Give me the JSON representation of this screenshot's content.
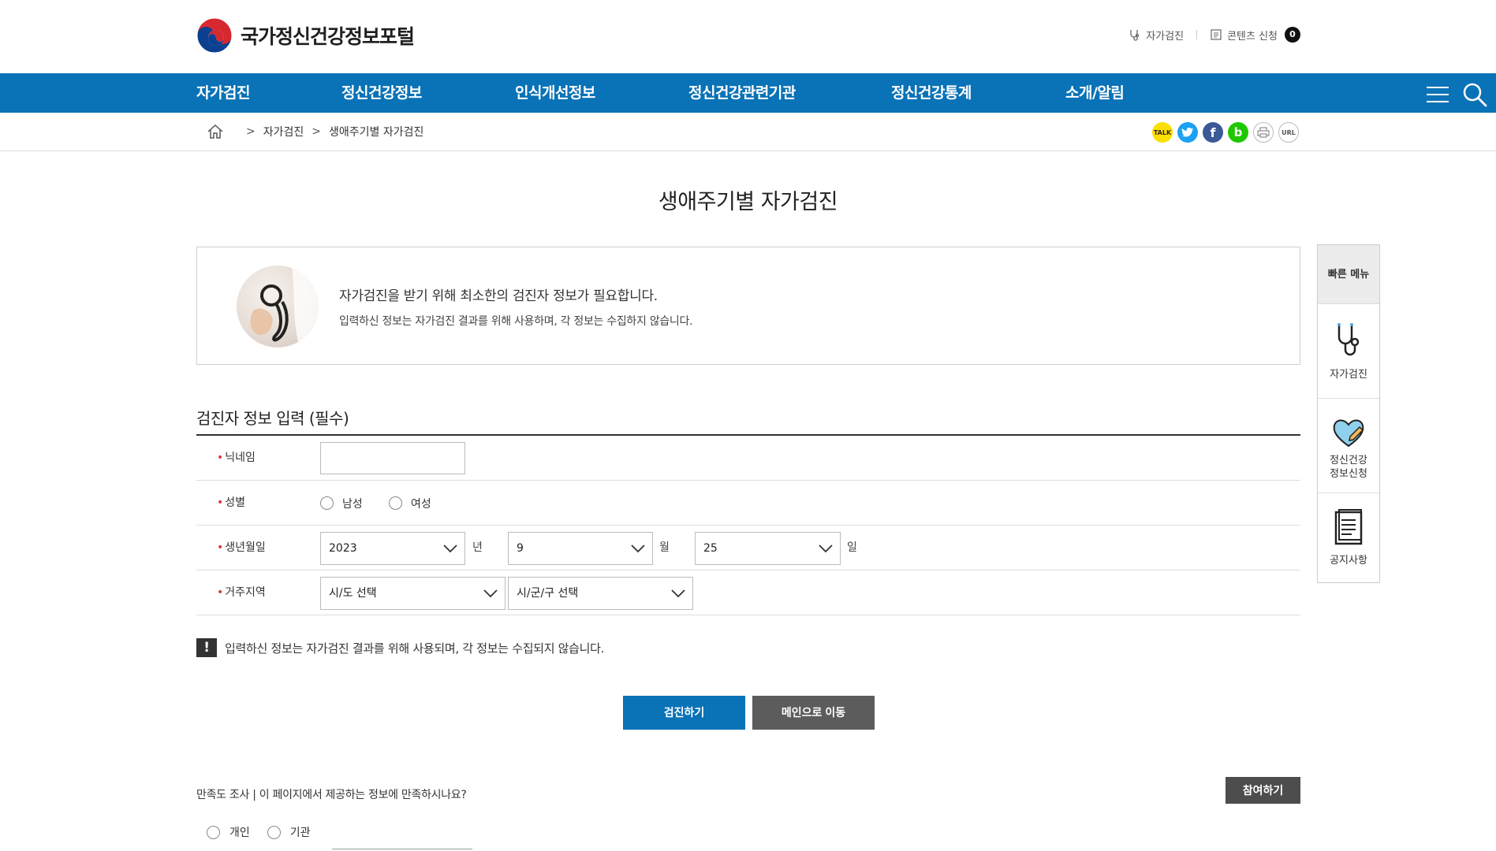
{
  "header": {
    "logo_text": "국가정신건강정보포털",
    "util": {
      "selfcheck_label": "자가검진",
      "content_request_label": "콘텐츠 신청",
      "content_count": "0"
    }
  },
  "gnb": {
    "items": [
      "자가검진",
      "정신건강정보",
      "인식개선정보",
      "정신건강관련기관",
      "정신건강통계",
      "소개/알림"
    ]
  },
  "breadcrumb": {
    "items": [
      "자가검진",
      "생애주기별 자가검진"
    ]
  },
  "share": {
    "kakao": "TALK",
    "band": "b",
    "url": "URL"
  },
  "page": {
    "title": "생애주기별 자가검진"
  },
  "info": {
    "line1": "자가검진을 받기 위해 최소한의 검진자 정보가 필요합니다.",
    "line2": "입력하신 정보는 자가검진 결과를 위해 사용하며, 각 정보는 수집하지 않습니다."
  },
  "form": {
    "title": "검진자 정보 입력 (필수)",
    "nickname_label": "닉네임",
    "gender_label": "성별",
    "gender_options": [
      "남성",
      "여성"
    ],
    "birth_label": "생년월일",
    "birth_year": "2023",
    "birth_year_unit": "년",
    "birth_month": "9",
    "birth_month_unit": "월",
    "birth_day": "25",
    "birth_day_unit": "일",
    "region_label": "거주지역",
    "region_sido": "시/도 선택",
    "region_sigungu": "시/군/구 선택"
  },
  "notice": "입력하신 정보는 자가검진 결과를 위해 사용되며, 각 정보는 수집되지 않습니다.",
  "buttons": {
    "check": "검진하기",
    "main": "메인으로 이동"
  },
  "survey": {
    "question": "만족도 조사 | 이 페이지에서 제공하는 정보에 만족하시나요?",
    "join": "참여하기",
    "options": [
      "개인",
      "기관"
    ]
  },
  "quick_menu": {
    "title": "빠른 메뉴",
    "items": [
      "자가검진",
      "정신건강\n정보신청",
      "공지사항"
    ],
    "item2_line1": "정신건강",
    "item2_line2": "정보신청"
  },
  "colors": {
    "primary": "#0a72b6",
    "dark_button": "#5c5c5c"
  }
}
